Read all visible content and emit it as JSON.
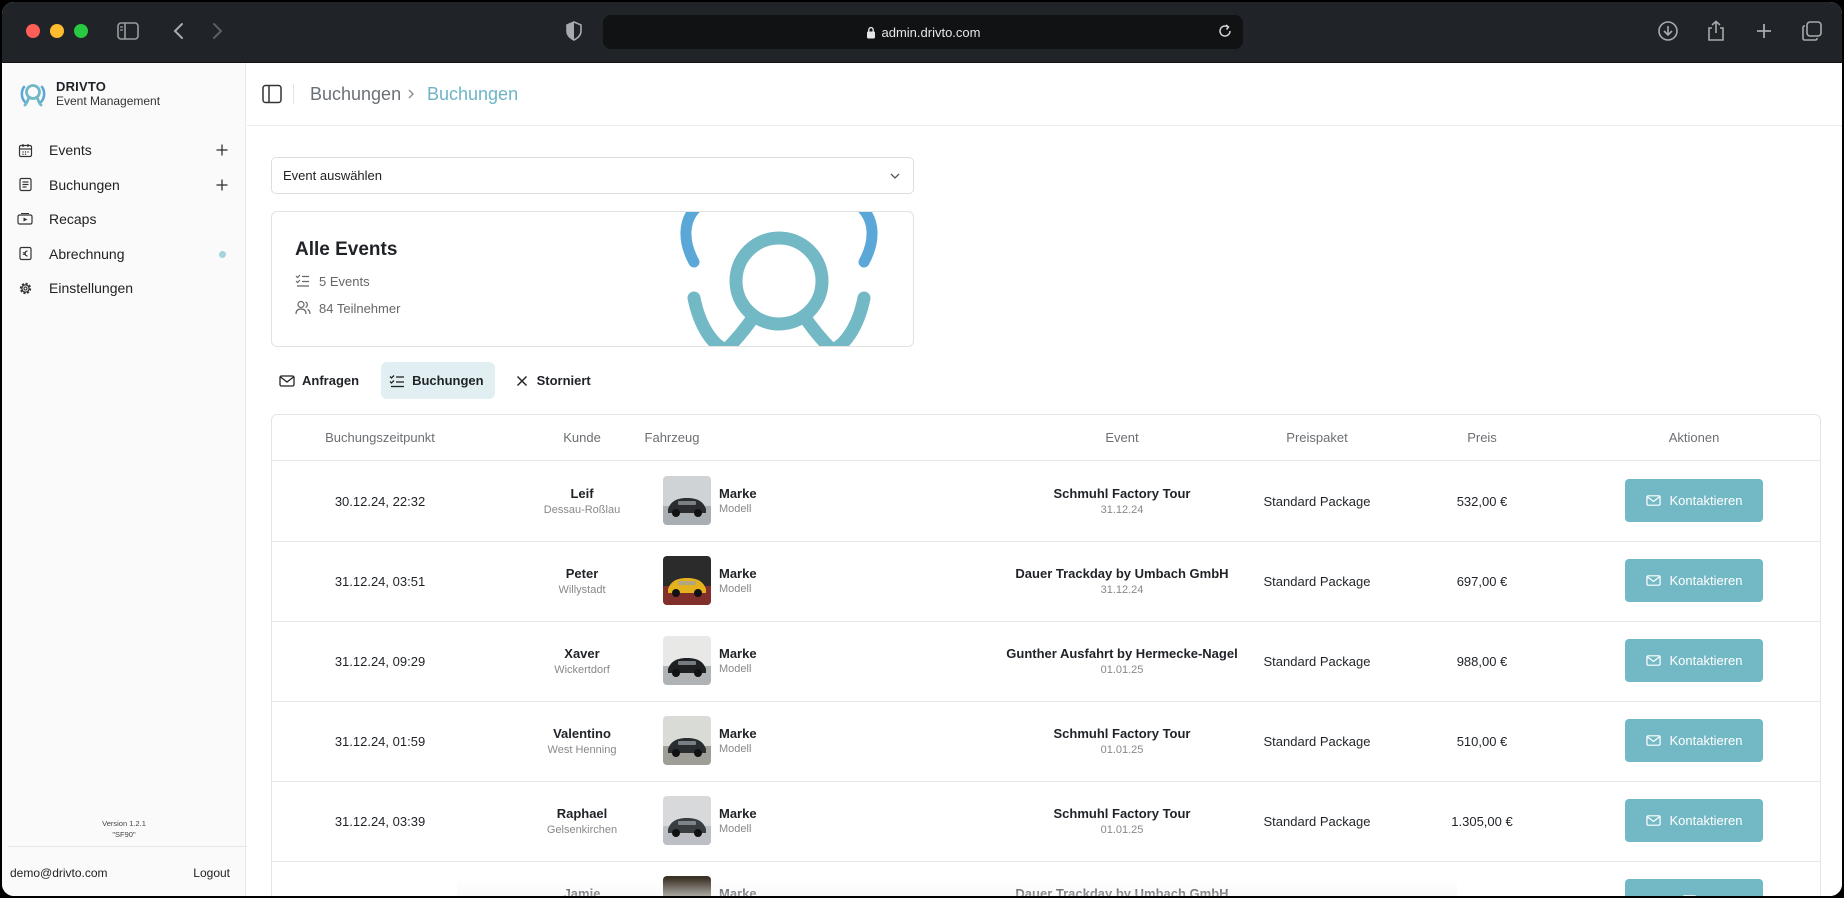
{
  "browser": {
    "url": "admin.drivto.com"
  },
  "sidebar": {
    "brand_title": "DRIVTO",
    "brand_subtitle": "Event Management",
    "items": [
      {
        "label": "Events",
        "icon": "calendar-icon",
        "has_plus": true
      },
      {
        "label": "Buchungen",
        "icon": "document-list-icon",
        "has_plus": true
      },
      {
        "label": "Recaps",
        "icon": "video-icon"
      },
      {
        "label": "Abrechnung",
        "icon": "euro-receipt-icon",
        "has_dot": true
      },
      {
        "label": "Einstellungen",
        "icon": "gear-icon"
      }
    ],
    "version": "Version 1.2.1",
    "version_code": "\"SF90\"",
    "email": "demo@drivto.com",
    "logout": "Logout"
  },
  "header": {
    "breadcrumb_parent": "Buchungen",
    "breadcrumb_current": "Buchungen"
  },
  "event_select": {
    "value": "Event auswählen"
  },
  "summary": {
    "title": "Alle Events",
    "events": "5 Events",
    "participants": "84 Teilnehmer"
  },
  "tabs": [
    {
      "label": "Anfragen",
      "icon": "mail-icon"
    },
    {
      "label": "Buchungen",
      "icon": "list-check-icon",
      "active": true
    },
    {
      "label": "Storniert",
      "icon": "x-icon"
    }
  ],
  "table": {
    "headers": {
      "time": "Buchungszeitpunkt",
      "customer": "Kunde",
      "vehicle": "Fahrzeug",
      "event": "Event",
      "package": "Preispaket",
      "price": "Preis",
      "actions": "Aktionen"
    },
    "rows": [
      {
        "time": "30.12.24, 22:32",
        "name": "Leif",
        "city": "Dessau-Roßlau",
        "brand": "Marke",
        "model": "Modell",
        "event": "Schmuhl Factory Tour",
        "date": "31.12.24",
        "package": "Standard Package",
        "price": "532,00 €",
        "action": "Kontaktieren"
      },
      {
        "time": "31.12.24, 03:51",
        "name": "Peter",
        "city": "Willystadt",
        "brand": "Marke",
        "model": "Modell",
        "event": "Dauer Trackday by Umbach GmbH",
        "date": "31.12.24",
        "package": "Standard Package",
        "price": "697,00 €",
        "action": "Kontaktieren"
      },
      {
        "time": "31.12.24, 09:29",
        "name": "Xaver",
        "city": "Wickertdorf",
        "brand": "Marke",
        "model": "Modell",
        "event": "Gunther Ausfahrt by Hermecke-Nagel",
        "date": "01.01.25",
        "package": "Standard Package",
        "price": "988,00 €",
        "action": "Kontaktieren"
      },
      {
        "time": "31.12.24, 01:59",
        "name": "Valentino",
        "city": "West Henning",
        "brand": "Marke",
        "model": "Modell",
        "event": "Schmuhl Factory Tour",
        "date": "01.01.25",
        "package": "Standard Package",
        "price": "510,00 €",
        "action": "Kontaktieren"
      },
      {
        "time": "31.12.24, 03:39",
        "name": "Raphael",
        "city": "Gelsenkirchen",
        "brand": "Marke",
        "model": "Modell",
        "event": "Schmuhl Factory Tour",
        "date": "01.01.25",
        "package": "Standard Package",
        "price": "1.305,00 €",
        "action": "Kontaktieren"
      },
      {
        "time": "",
        "name": "Jamie",
        "city": "",
        "brand": "Marke",
        "model": "",
        "event": "Dauer Trackday by Umbach GmbH",
        "date": "",
        "package": "",
        "price": "",
        "action": ""
      }
    ]
  },
  "colors": {
    "accent": "#73b9c5",
    "breadcrumb_active": "#6bb5c6",
    "tab_active_bg": "#e2eff2"
  }
}
